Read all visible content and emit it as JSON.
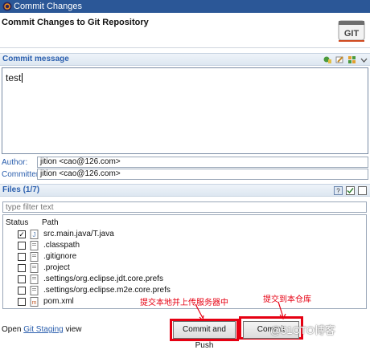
{
  "window": {
    "title": "Commit Changes"
  },
  "header": {
    "heading": "Commit Changes to Git Repository",
    "logo_text": "GIT"
  },
  "commit_message": {
    "section_title": "Commit message",
    "text": "test"
  },
  "author": {
    "label": "Author:",
    "value": "jition <cao@126.com>"
  },
  "committer": {
    "label": "Committer:",
    "value": "jition <cao@126.com>"
  },
  "files": {
    "section_title": "Files (1/7)",
    "filter_placeholder": "type filter text",
    "columns": {
      "status": "Status",
      "path": "Path"
    },
    "rows": [
      {
        "path": "src.main.java/T.java",
        "checked": true
      },
      {
        "path": ".classpath",
        "checked": false
      },
      {
        "path": ".gitignore",
        "checked": false
      },
      {
        "path": ".project",
        "checked": false
      },
      {
        "path": ".settings/org.eclipse.jdt.core.prefs",
        "checked": false
      },
      {
        "path": ".settings/org.eclipse.m2e.core.prefs",
        "checked": false
      },
      {
        "path": "pom.xml",
        "checked": false
      }
    ]
  },
  "annotations": {
    "push": "提交本地并上传服务器中",
    "commit": "提交到本仓库"
  },
  "footer": {
    "open_text": "Open",
    "link": "Git Staging",
    "view_text": "view"
  },
  "buttons": {
    "commit_and_push": "Commit and Push",
    "commit": "Commit"
  },
  "watermark": "@51CTO博客",
  "colors": {
    "titlebar": "#2b5797",
    "annotation": "#e60012",
    "section_title": "#2b5fae"
  }
}
